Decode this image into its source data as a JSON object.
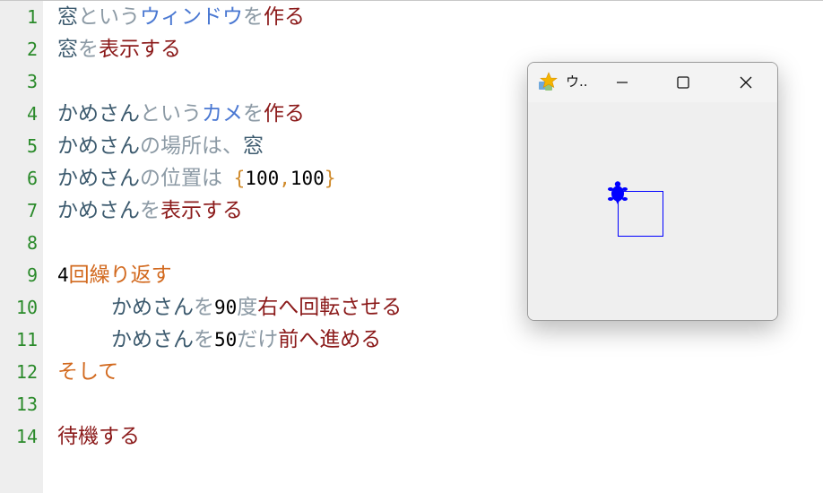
{
  "editor": {
    "line_numbers": [
      "1",
      "2",
      "3",
      "4",
      "5",
      "6",
      "7",
      "8",
      "9",
      "10",
      "11",
      "12",
      "13",
      "14"
    ],
    "lines": [
      [
        {
          "text": "窓",
          "color": "#3c5a6e"
        },
        {
          "text": "という",
          "color": "#8c9aa5"
        },
        {
          "text": "ウィンドウ",
          "color": "#4a78d2"
        },
        {
          "text": "を",
          "color": "#8c9aa5"
        },
        {
          "text": "作る",
          "color": "#8b1a1a"
        }
      ],
      [
        {
          "text": "窓",
          "color": "#3c5a6e"
        },
        {
          "text": "を",
          "color": "#8c9aa5"
        },
        {
          "text": "表示する",
          "color": "#8b1a1a"
        }
      ],
      [],
      [
        {
          "text": "かめさん",
          "color": "#3c5a6e"
        },
        {
          "text": "という",
          "color": "#8c9aa5"
        },
        {
          "text": "カメ",
          "color": "#4a78d2"
        },
        {
          "text": "を",
          "color": "#8c9aa5"
        },
        {
          "text": "作る",
          "color": "#8b1a1a"
        }
      ],
      [
        {
          "text": "かめさん",
          "color": "#3c5a6e"
        },
        {
          "text": "の場所は、",
          "color": "#8c9aa5"
        },
        {
          "text": "窓",
          "color": "#3c5a6e"
        }
      ],
      [
        {
          "text": "かめさん",
          "color": "#3c5a6e"
        },
        {
          "text": "の位置は",
          "color": "#8c9aa5"
        },
        {
          "text": " {",
          "color": "#d08a2a",
          "cls": "punct"
        },
        {
          "text": "100",
          "color": "#000000",
          "cls": "num"
        },
        {
          "text": ",",
          "color": "#d08a2a",
          "cls": "punct"
        },
        {
          "text": "100",
          "color": "#000000",
          "cls": "num"
        },
        {
          "text": "}",
          "color": "#d08a2a",
          "cls": "punct"
        }
      ],
      [
        {
          "text": "かめさん",
          "color": "#3c5a6e"
        },
        {
          "text": "を",
          "color": "#8c9aa5"
        },
        {
          "text": "表示する",
          "color": "#8b1a1a"
        }
      ],
      [],
      [
        {
          "text": "4",
          "color": "#000000",
          "cls": "num"
        },
        {
          "text": "回繰り返す",
          "color": "#d2691e"
        }
      ],
      [
        {
          "text": "かめさん",
          "color": "#3c5a6e"
        },
        {
          "text": "を",
          "color": "#8c9aa5"
        },
        {
          "text": "90",
          "color": "#000000",
          "cls": "num"
        },
        {
          "text": "度",
          "color": "#8c9aa5"
        },
        {
          "text": "右へ回転させる",
          "color": "#8b1a1a"
        }
      ],
      [
        {
          "text": "かめさん",
          "color": "#3c5a6e"
        },
        {
          "text": "を",
          "color": "#8c9aa5"
        },
        {
          "text": "50",
          "color": "#000000",
          "cls": "num"
        },
        {
          "text": "だけ",
          "color": "#8c9aa5"
        },
        {
          "text": "前へ進める",
          "color": "#8b1a1a"
        }
      ],
      [
        {
          "text": "そして",
          "color": "#d2691e"
        }
      ],
      [],
      [
        {
          "text": "待機する",
          "color": "#8b1a1a"
        }
      ]
    ],
    "indented_lines": [
      9,
      10
    ]
  },
  "window": {
    "title": "ウ..",
    "icon": "star-app-icon",
    "minimize_icon": "minimize-icon",
    "maximize_icon": "maximize-icon",
    "close_icon": "close-icon"
  },
  "canvas": {
    "turtle_color": "#0000ff",
    "square_color": "#0000ff",
    "icon": "turtle-icon"
  }
}
